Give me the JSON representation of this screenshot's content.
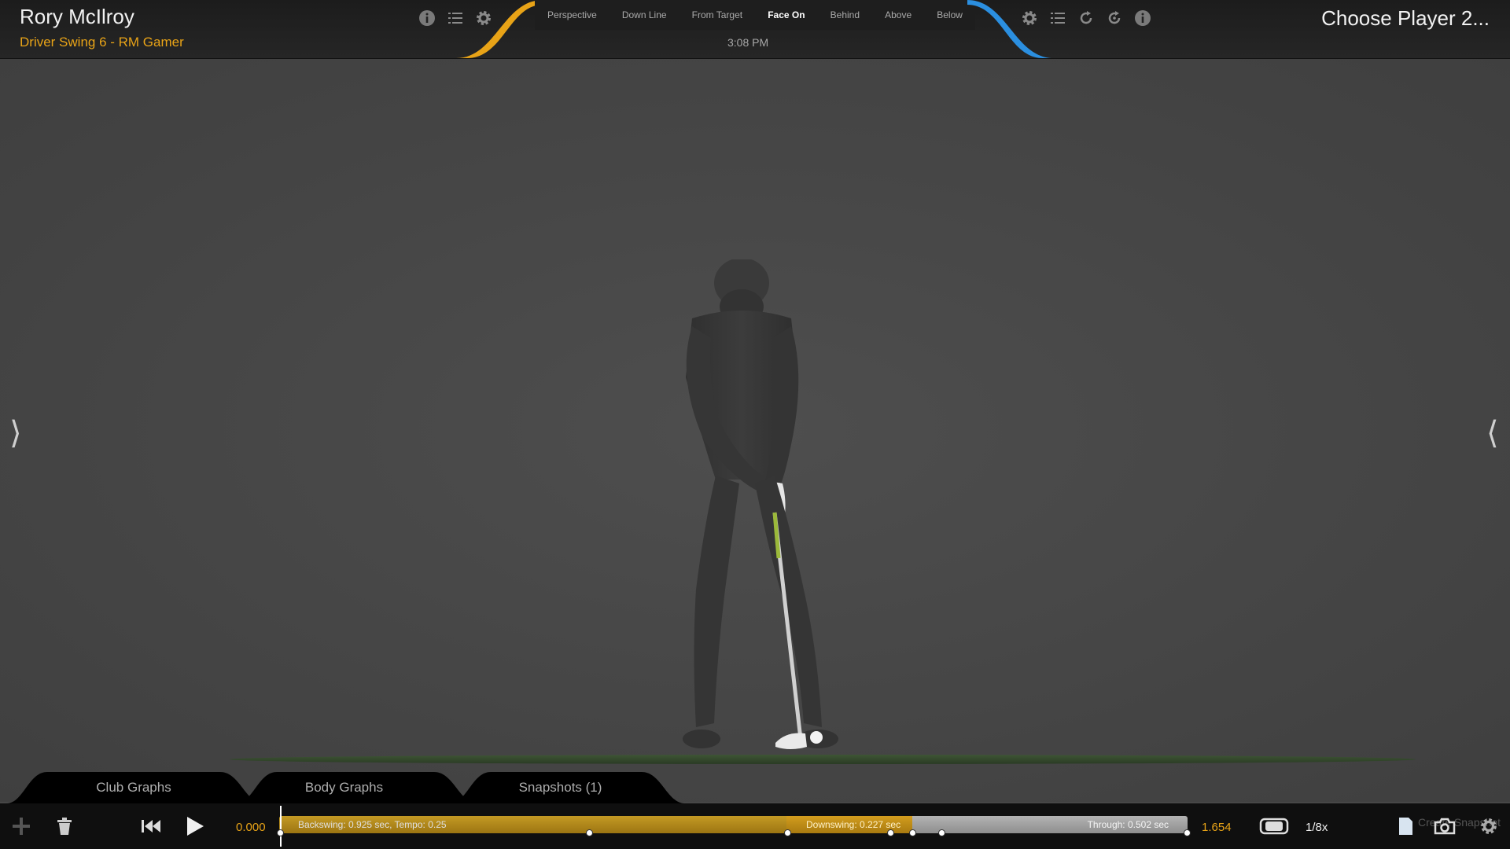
{
  "header": {
    "left_player_name": "Rory McIlroy",
    "left_swing_name": "Driver Swing 6 - RM Gamer",
    "right_player_label": "Choose Player 2...",
    "clock": "3:08 PM",
    "view_tabs": [
      {
        "label": "Perspective",
        "active": false
      },
      {
        "label": "Down Line",
        "active": false
      },
      {
        "label": "From Target",
        "active": false
      },
      {
        "label": "Face On",
        "active": true
      },
      {
        "label": "Behind",
        "active": false
      },
      {
        "label": "Above",
        "active": false
      },
      {
        "label": "Below",
        "active": false
      }
    ],
    "left_icons": [
      "info-icon",
      "list-icon",
      "gear-icon"
    ],
    "right_icons": [
      "gear-icon",
      "list-icon",
      "rotate-icon",
      "reset-rotate-icon",
      "info-icon"
    ]
  },
  "colors": {
    "accent_left": "#e8a317",
    "accent_right": "#2b8fe0",
    "backswing": "#b38a1b",
    "downswing": "#c48f14",
    "through": "#a0a0a0"
  },
  "side_arrows": {
    "left": "⟩",
    "right": "⟨"
  },
  "bottom_tabs": [
    "Club Graphs",
    "Body Graphs",
    "Snapshots (1)"
  ],
  "toolbar": {
    "start_time": "0.000",
    "end_time": "1.654",
    "backswing_label": "Backswing: 0.925 sec, Tempo: 0.25",
    "downswing_label": "Downswing: 0.227 sec",
    "through_label": "Through: 0.502 sec",
    "speed": "1/8x",
    "snapshot_label": "Create Snapshot",
    "icons": [
      "plus-icon",
      "trash-icon",
      "skip-back-icon",
      "play-icon",
      "frame-icon",
      "document-icon",
      "camera-icon",
      "gear-icon"
    ]
  }
}
